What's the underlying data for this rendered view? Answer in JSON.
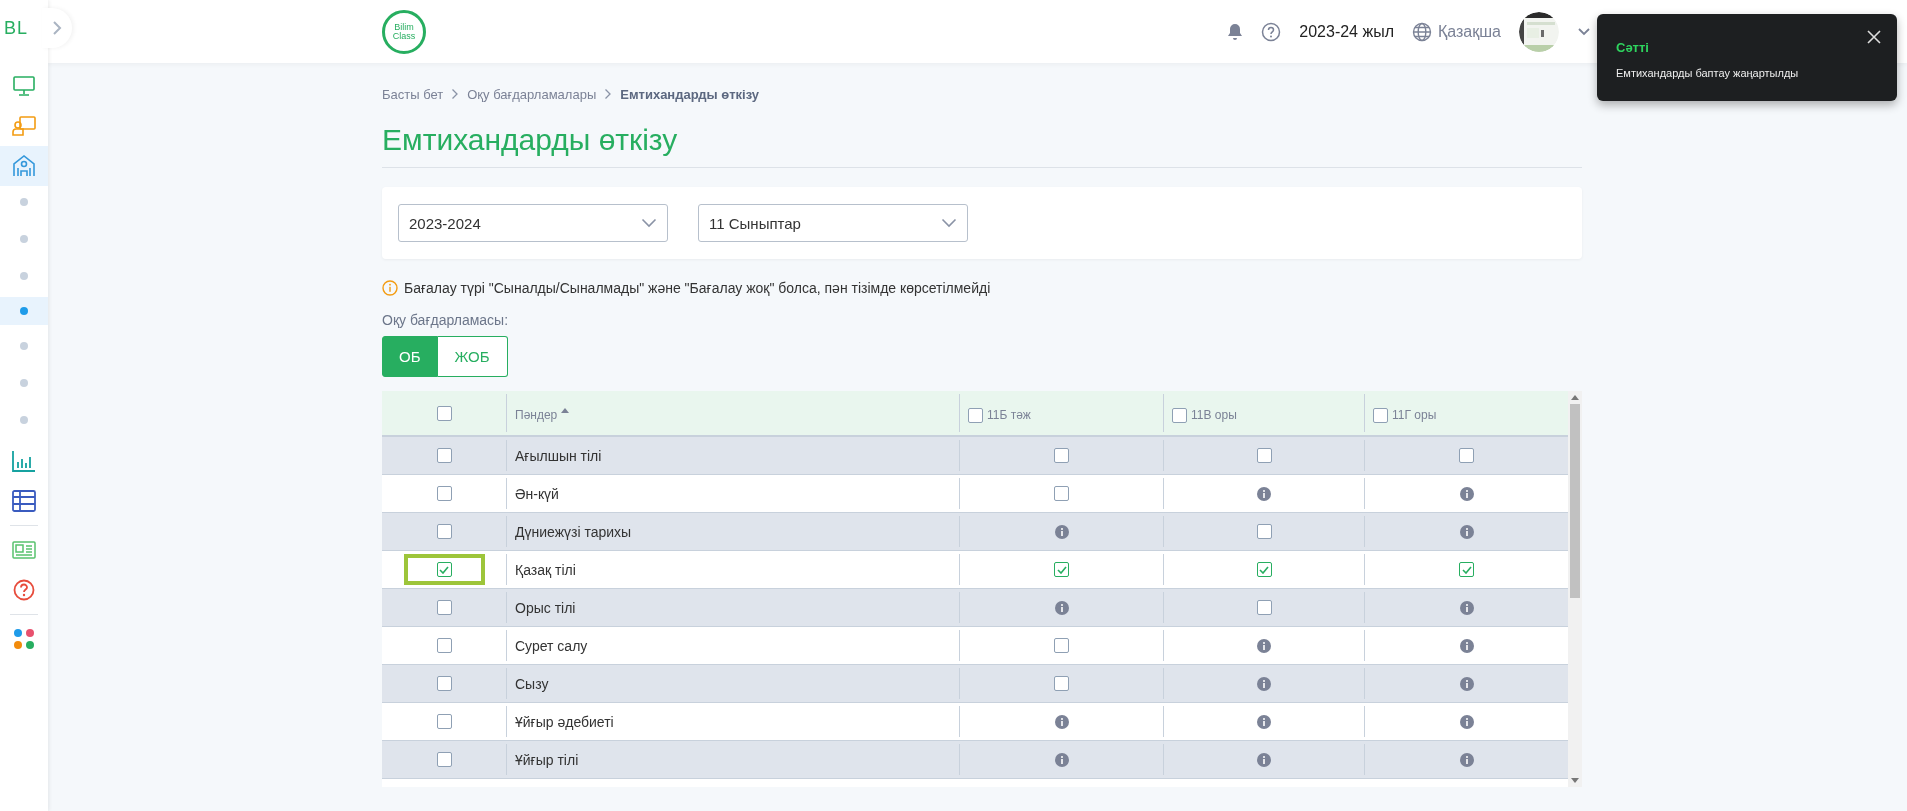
{
  "sidebar": {
    "logo": "BL",
    "items": [
      {
        "kind": "monitor",
        "selected": false
      },
      {
        "kind": "board",
        "selected": false
      },
      {
        "kind": "school",
        "selected": true
      },
      {
        "kind": "dot",
        "selected": false
      },
      {
        "kind": "dot",
        "selected": false
      },
      {
        "kind": "dot",
        "selected": false
      },
      {
        "kind": "dot",
        "selected": true
      },
      {
        "kind": "dot",
        "selected": false
      },
      {
        "kind": "dot",
        "selected": false
      },
      {
        "kind": "dot",
        "selected": false
      },
      {
        "kind": "chart",
        "selected": false
      },
      {
        "kind": "table",
        "selected": false
      }
    ],
    "tools": [
      {
        "kind": "news",
        "selected": false
      },
      {
        "kind": "help",
        "selected": false
      }
    ],
    "apps": [
      {
        "kind": "apps",
        "selected": false
      }
    ]
  },
  "header": {
    "logo": "Bilim Class",
    "year": "2023-24 жыл",
    "language": "Қазақша"
  },
  "toast": {
    "title": "Сәтті",
    "message": "Емтихандарды баптау жаңартылды"
  },
  "breadcrumbs": [
    "Басты бет",
    "Оқу бағдарламалары",
    "Емтихандарды өткізу"
  ],
  "title": "Емтихандарды өткізу",
  "filters": [
    {
      "value": "2023-2024"
    },
    {
      "value": "11 Сыныптар"
    }
  ],
  "notice": "Бағалау түрі \"Сыналды/Сыналмады\" және \"Бағалау жоқ\" болса, пән тізімде көрсетілмейді",
  "program_label": "Оқу бағдарламасы:",
  "program_tabs": [
    {
      "label": "ОБ",
      "selected": true
    },
    {
      "label": "ЖОБ",
      "selected": false
    }
  ],
  "table": {
    "all_checked": false,
    "subject_column": {
      "label": "Пәндер",
      "sorted": true
    },
    "columns": [
      {
        "label": "11Б тәж",
        "checked": false
      },
      {
        "label": "11В оры",
        "checked": false
      },
      {
        "label": "11Г оры",
        "checked": false
      }
    ],
    "rows": [
      {
        "subject": "Ағылшын тілі",
        "checked": false,
        "highlighted": false,
        "cells": [
          {
            "kind": "checkbox",
            "checked": false
          },
          {
            "kind": "checkbox",
            "checked": false
          },
          {
            "kind": "checkbox",
            "checked": false
          }
        ]
      },
      {
        "subject": "Ән-күй",
        "checked": false,
        "highlighted": false,
        "cells": [
          {
            "kind": "checkbox",
            "checked": false
          },
          {
            "kind": "info"
          },
          {
            "kind": "info"
          }
        ]
      },
      {
        "subject": "Дүниежүзі тарихы",
        "checked": false,
        "highlighted": false,
        "cells": [
          {
            "kind": "info"
          },
          {
            "kind": "checkbox",
            "checked": false
          },
          {
            "kind": "info"
          }
        ]
      },
      {
        "subject": "Қазақ тілі",
        "checked": true,
        "highlighted": true,
        "cells": [
          {
            "kind": "checkbox",
            "checked": true
          },
          {
            "kind": "checkbox",
            "checked": true
          },
          {
            "kind": "checkbox",
            "checked": true
          }
        ]
      },
      {
        "subject": "Орыс тілі",
        "checked": false,
        "highlighted": false,
        "cells": [
          {
            "kind": "info"
          },
          {
            "kind": "checkbox",
            "checked": false
          },
          {
            "kind": "info"
          }
        ]
      },
      {
        "subject": "Сурет салу",
        "checked": false,
        "highlighted": false,
        "cells": [
          {
            "kind": "checkbox",
            "checked": false
          },
          {
            "kind": "info"
          },
          {
            "kind": "info"
          }
        ]
      },
      {
        "subject": "Сызу",
        "checked": false,
        "highlighted": false,
        "cells": [
          {
            "kind": "checkbox",
            "checked": false
          },
          {
            "kind": "info"
          },
          {
            "kind": "info"
          }
        ]
      },
      {
        "subject": "Ұйғыр әдебиеті",
        "checked": false,
        "highlighted": false,
        "cells": [
          {
            "kind": "info"
          },
          {
            "kind": "info"
          },
          {
            "kind": "info"
          }
        ]
      },
      {
        "subject": "Ұйғыр тілі",
        "checked": false,
        "highlighted": false,
        "cells": [
          {
            "kind": "info"
          },
          {
            "kind": "info"
          },
          {
            "kind": "info"
          }
        ]
      }
    ]
  }
}
